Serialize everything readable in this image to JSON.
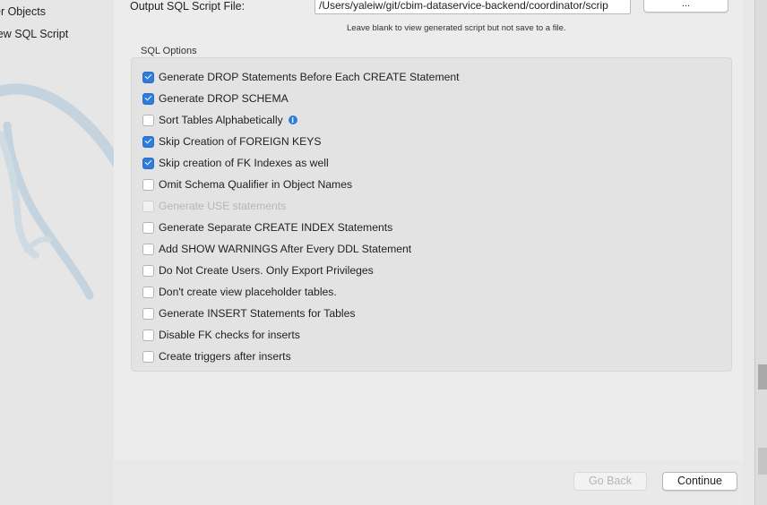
{
  "sidebar": {
    "items": [
      {
        "label": "er Objects"
      },
      {
        "label": "iew SQL Script"
      }
    ]
  },
  "output": {
    "label": "Output SQL Script File:",
    "path_value": "/Users/yaleiw/git/cbim-dataservice-backend/coordinator/scrip",
    "browse_label": "...",
    "hint": "Leave blank to view generated script but not save to a file."
  },
  "sql_options": {
    "title": "SQL Options",
    "options": [
      {
        "label": "Generate DROP Statements Before Each CREATE Statement",
        "checked": true,
        "disabled": false
      },
      {
        "label": "Generate DROP SCHEMA",
        "checked": true,
        "disabled": false
      },
      {
        "label": "Sort Tables Alphabetically",
        "checked": false,
        "disabled": false,
        "info": true
      },
      {
        "label": "Skip Creation of FOREIGN KEYS",
        "checked": true,
        "disabled": false
      },
      {
        "label": "Skip creation of FK Indexes as well",
        "checked": true,
        "disabled": false
      },
      {
        "label": "Omit Schema Qualifier in Object Names",
        "checked": false,
        "disabled": false
      },
      {
        "label": "Generate USE statements",
        "checked": false,
        "disabled": true
      },
      {
        "label": "Generate Separate CREATE INDEX Statements",
        "checked": false,
        "disabled": false
      },
      {
        "label": "Add SHOW WARNINGS After Every DDL Statement",
        "checked": false,
        "disabled": false
      },
      {
        "label": "Do Not Create Users. Only Export Privileges",
        "checked": false,
        "disabled": false
      },
      {
        "label": "Don't create view placeholder tables.",
        "checked": false,
        "disabled": false
      },
      {
        "label": "Generate INSERT Statements for Tables",
        "checked": false,
        "disabled": false
      },
      {
        "label": "Disable FK checks for inserts",
        "checked": false,
        "disabled": false
      },
      {
        "label": "Create triggers after inserts",
        "checked": false,
        "disabled": false
      }
    ]
  },
  "footer": {
    "back_label": "Go Back",
    "continue_label": "Continue"
  },
  "colors": {
    "accent": "#2f7ddb",
    "dolphin": "#b8cad6"
  },
  "icons": {
    "info": "info-icon",
    "logo": "mysql-dolphin-logo"
  }
}
